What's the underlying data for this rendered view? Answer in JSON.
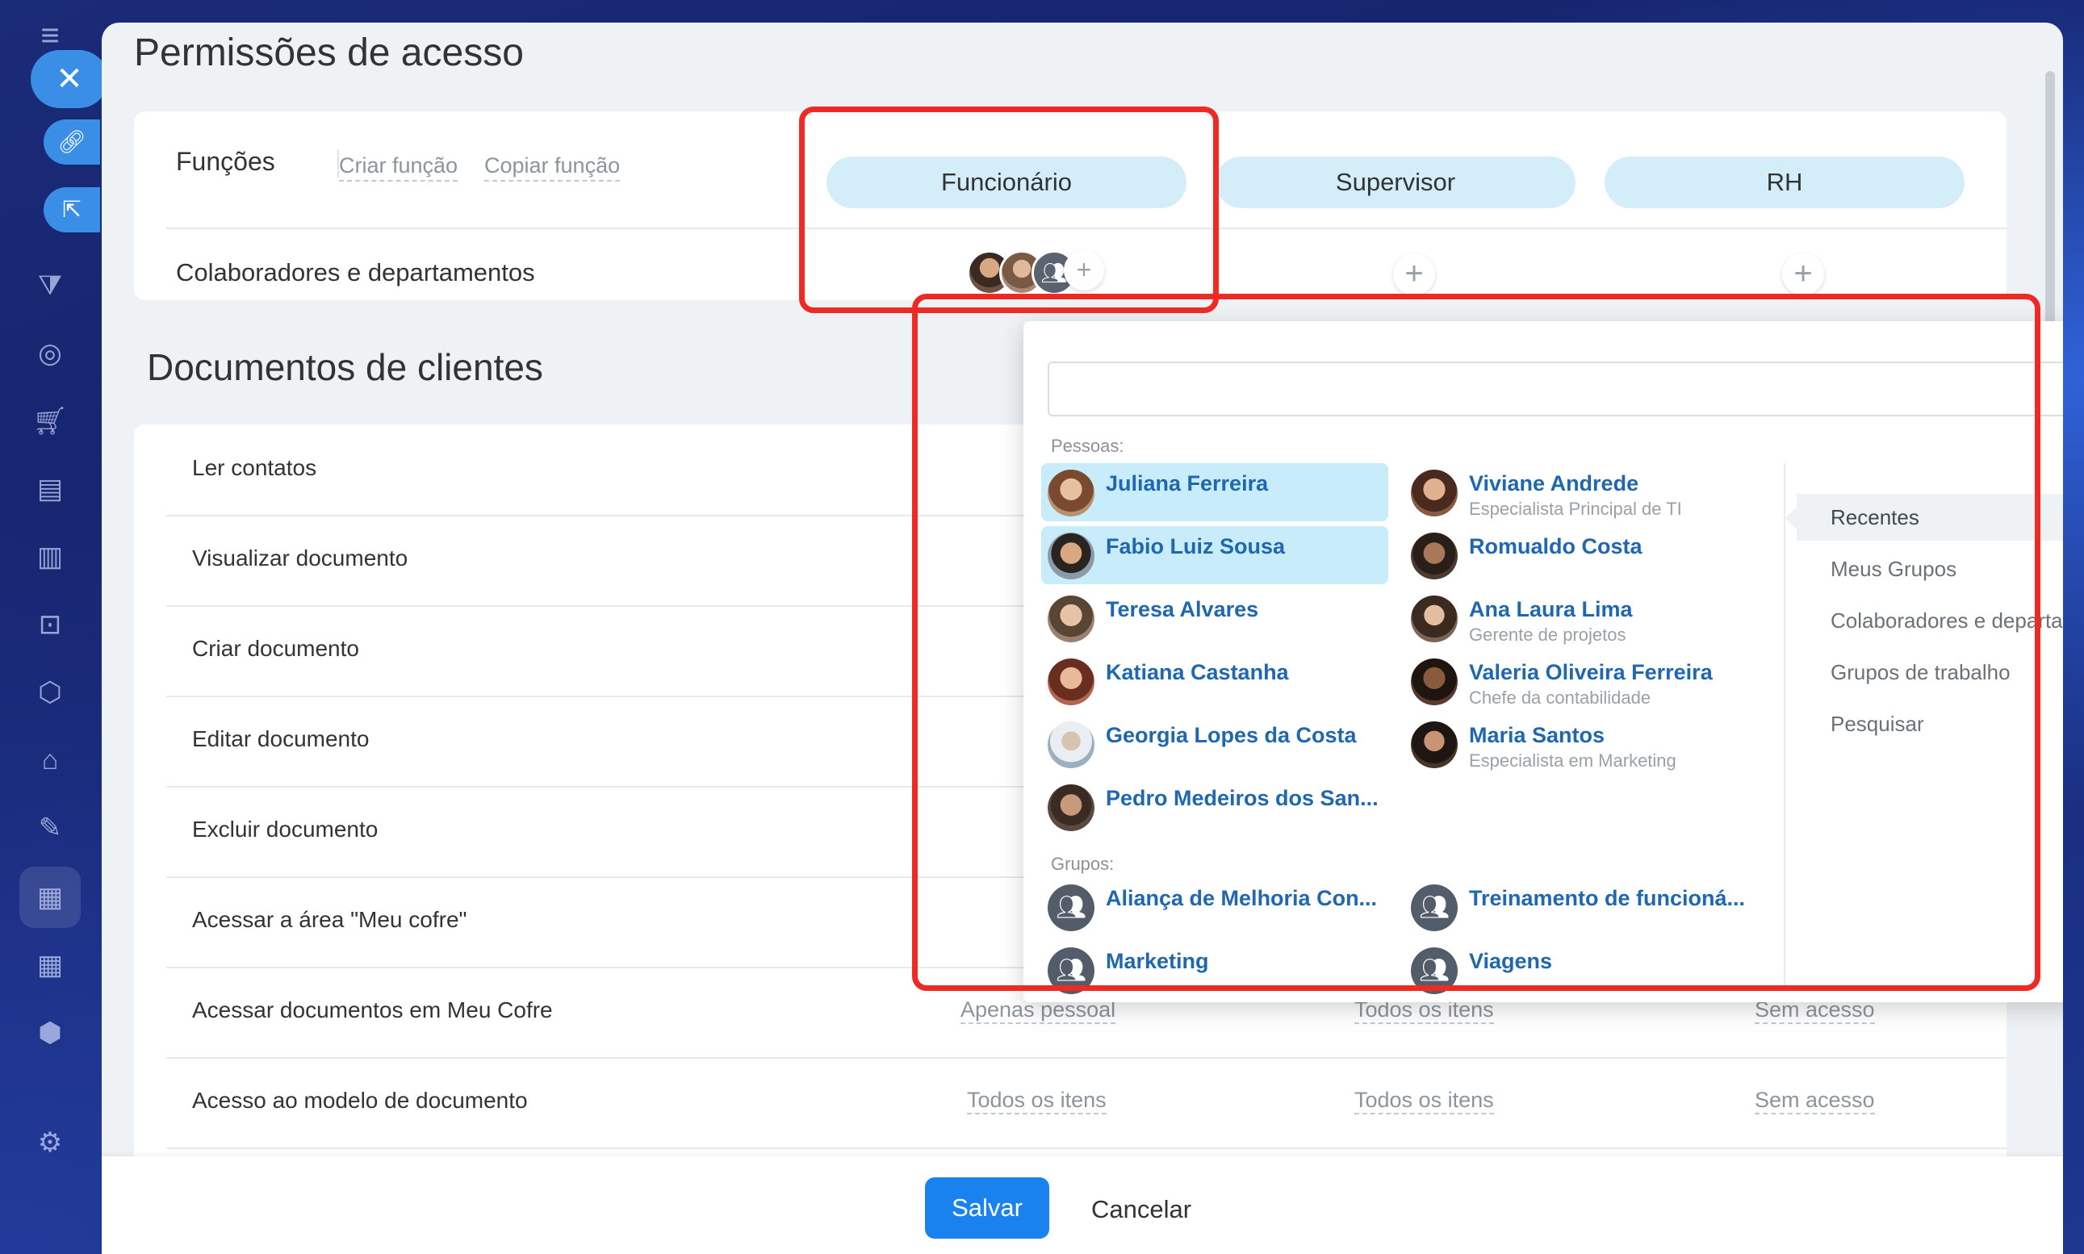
{
  "page": {
    "title": "Permissões de acesso",
    "section_title": "Documentos de clientes"
  },
  "roles_card": {
    "label": "Funções",
    "create_link": "Criar função",
    "copy_link": "Copiar função",
    "collab_label": "Colaboradores e departamentos",
    "roles": [
      "Funcionário",
      "Supervisor",
      "RH"
    ]
  },
  "permissions": [
    {
      "label": "Ler contatos"
    },
    {
      "label": "Visualizar documento"
    },
    {
      "label": "Criar documento"
    },
    {
      "label": "Editar documento"
    },
    {
      "label": "Excluir documento"
    },
    {
      "label": "Acessar a área \"Meu cofre\""
    },
    {
      "label": "Acessar documentos em Meu Cofre",
      "values": [
        "Apenas pessoal",
        "Todos os itens",
        "Sem acesso"
      ]
    },
    {
      "label": "Acesso ao modelo de documento",
      "values": [
        "Todos os itens",
        "Todos os itens",
        "Sem acesso"
      ]
    }
  ],
  "footer": {
    "save": "Salvar",
    "cancel": "Cancelar"
  },
  "popup": {
    "search_value": "",
    "people_label": "Pessoas:",
    "groups_label": "Grupos:",
    "people": [
      {
        "name": "Juliana Ferreira",
        "title": "",
        "selected": true
      },
      {
        "name": "Viviane Andrede",
        "title": "Especialista Principal de TI",
        "selected": false
      },
      {
        "name": "Fabio Luiz Sousa",
        "title": "",
        "selected": true
      },
      {
        "name": "Romualdo Costa",
        "title": "",
        "selected": false
      },
      {
        "name": "Teresa Alvares",
        "title": "",
        "selected": false
      },
      {
        "name": "Ana Laura Lima",
        "title": "Gerente de projetos",
        "selected": false
      },
      {
        "name": "Katiana Castanha",
        "title": "",
        "selected": false
      },
      {
        "name": "Valeria Oliveira Ferreira",
        "title": "Chefe da contabilidade",
        "selected": false
      },
      {
        "name": "Georgia Lopes da Costa",
        "title": "",
        "selected": false
      },
      {
        "name": "Maria Santos",
        "title": "Especialista em Marketing",
        "selected": false
      },
      {
        "name": "Pedro Medeiros dos San...",
        "title": "",
        "selected": false
      }
    ],
    "groups": [
      {
        "name": "Aliança de Melhoria Con..."
      },
      {
        "name": "Treinamento de funcioná..."
      },
      {
        "name": "Marketing"
      },
      {
        "name": "Viagens"
      }
    ],
    "tabs": [
      {
        "label": "Recentes",
        "active": true
      },
      {
        "label": "Meus Grupos",
        "active": false
      },
      {
        "label": "Colaboradores e departam...",
        "active": false
      },
      {
        "label": "Grupos de trabalho",
        "active": false
      },
      {
        "label": "Pesquisar",
        "active": false
      }
    ]
  },
  "colors": {
    "accent": "#1a82ef",
    "highlight_frame": "#ee2a24",
    "role_pill": "#d4eef9",
    "selected_person": "#c8ecfa",
    "link": "#2067b0"
  }
}
